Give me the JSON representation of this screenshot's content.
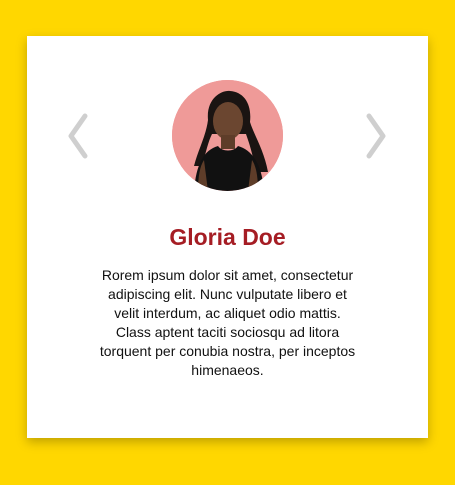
{
  "colors": {
    "background": "#FFD700",
    "card": "#FFFFFF",
    "name": "#A51D24",
    "arrow": "#CFCFCF",
    "avatar_bg": "#EF9A98"
  },
  "carousel": {
    "prev_icon": "chevron-left-icon",
    "next_icon": "chevron-right-icon"
  },
  "testimonial": {
    "name": "Gloria Doe",
    "text": "Rorem ipsum dolor sit amet, consectetur adipiscing elit. Nunc vulputate libero et velit interdum, ac aliquet odio mattis. Class aptent taciti sociosqu ad litora torquent per conubia nostra, per inceptos himenaeos."
  }
}
